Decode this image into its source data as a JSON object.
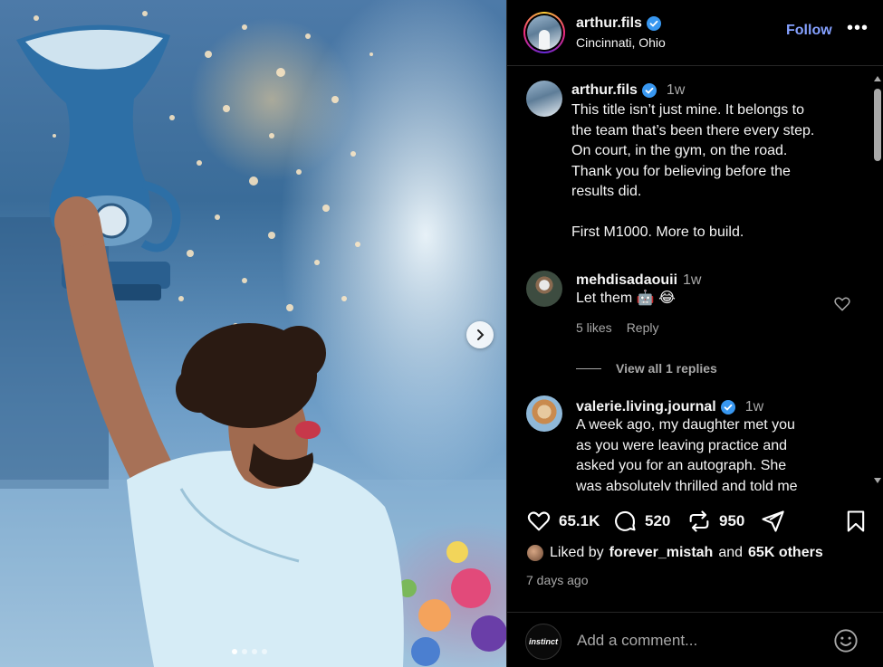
{
  "post": {
    "author": "arthur.fils",
    "location": "Cincinnati, Ohio",
    "follow_label": "Follow",
    "more_label": "•••"
  },
  "caption": {
    "author": "arthur.fils",
    "time": "1w",
    "lines": [
      "This title isn’t just mine. It belongs to",
      "the team that’s been there every step.",
      "On court, in the gym, on the road.",
      "Thank you for believing before the",
      "results did."
    ],
    "closing": "First M1000. More to build."
  },
  "comments": [
    {
      "author": "mehdisadaouii",
      "time": "1w",
      "text": "Let them 🤖 😂",
      "likes": "5 likes",
      "reply_label": "Reply",
      "view_replies": "View all 1 replies"
    },
    {
      "author": "valerie.living.journal",
      "time": "1w",
      "lines": [
        "A week ago, my daughter met you",
        "as you were leaving practice and",
        "asked you for an autograph. She",
        "was absolutely thrilled and told me"
      ]
    }
  ],
  "actions": {
    "likes_count": "65.1K",
    "comments_count": "520",
    "reposts_count": "950"
  },
  "liked_by": {
    "prefix": "Liked by",
    "user": "forever_mistah",
    "connector": "and",
    "others": "65K others"
  },
  "date": "7 days ago",
  "composer": {
    "placeholder": "Add a comment...",
    "brand": "instinct"
  },
  "carousel": {
    "slides": 4,
    "active": 0
  },
  "colors": {
    "accent_follow": "#85a1ff",
    "verified": "#3897f0",
    "muted": "#a8a8a8"
  },
  "icons": [
    "verified-icon",
    "more-icon",
    "heart-icon",
    "comment-icon",
    "repost-icon",
    "share-icon",
    "save-icon",
    "emoji-icon",
    "chevron-right-icon"
  ]
}
